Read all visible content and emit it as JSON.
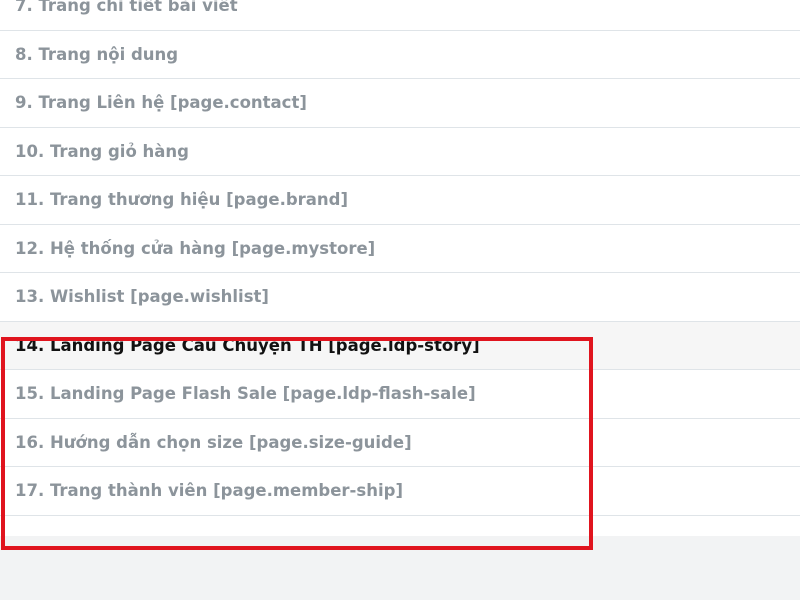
{
  "pages_list": {
    "items": [
      {
        "label": "7. Trang chi tiết bài viết",
        "active": false
      },
      {
        "label": "8. Trang nội dung",
        "active": false
      },
      {
        "label": "9. Trang Liên hệ [page.contact]",
        "active": false
      },
      {
        "label": "10. Trang giỏ hàng",
        "active": false
      },
      {
        "label": "11. Trang thương hiệu [page.brand]",
        "active": false
      },
      {
        "label": "12. Hệ thống cửa hàng [page.mystore]",
        "active": false
      },
      {
        "label": "13. Wishlist [page.wishlist]",
        "active": false
      },
      {
        "label": "14. Landing Page Câu Chuyện TH [page.ldp-story]",
        "active": true
      },
      {
        "label": "15. Landing Page Flash Sale [page.ldp-flash-sale]",
        "active": false
      },
      {
        "label": "16. Hướng dẫn chọn size [page.size-guide]",
        "active": false
      },
      {
        "label": "17. Trang thành viên [page.member-ship]",
        "active": false
      }
    ]
  },
  "colors": {
    "highlight_border": "#e0141e",
    "active_text": "#111111",
    "inactive_text": "#8c949b"
  }
}
